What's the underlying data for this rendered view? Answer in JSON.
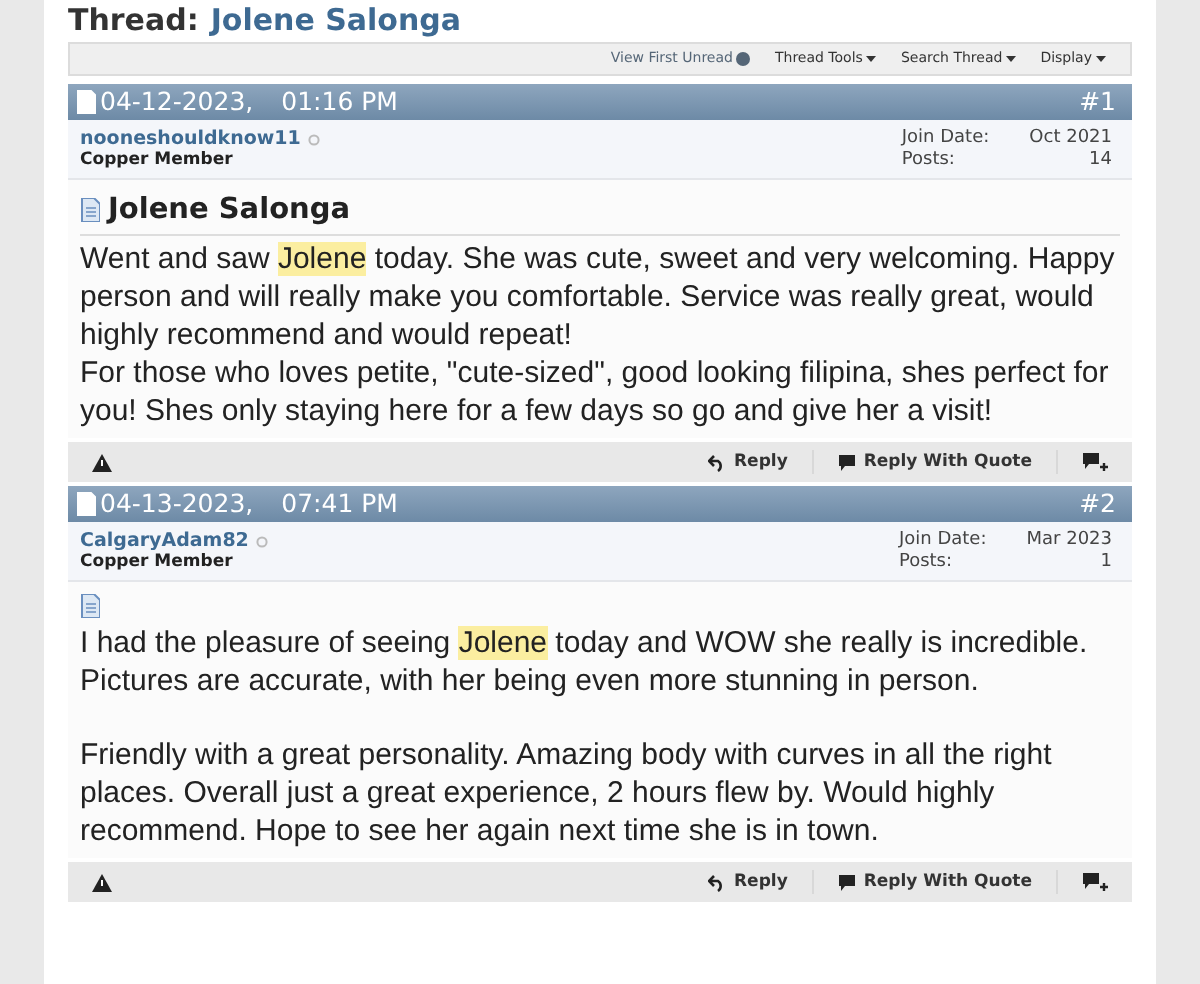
{
  "thread_title": {
    "label": "Thread:",
    "name": "Jolene Salonga"
  },
  "toolbar": [
    {
      "label": "View First Unread",
      "kind": "info"
    },
    {
      "label": "Thread Tools",
      "kind": "menu"
    },
    {
      "label": "Search Thread",
      "kind": "menu"
    },
    {
      "label": "Display",
      "kind": "menu"
    }
  ],
  "posts": [
    {
      "date": "04-12-2023,",
      "time": "01:16 PM",
      "number": "#1",
      "username": "nooneshouldknow11",
      "rank": "Copper Member",
      "join_label": "Join Date:",
      "join_date": "Oct 2021",
      "posts_label": "Posts:",
      "posts": "14",
      "title": "Jolene Salonga",
      "paragraphs": [
        {
          "before": "Went and saw ",
          "highlight": "Jolene",
          "after": " today. She was cute, sweet and very welcoming. Happy person and will really make you comfortable. Service was really great, would highly recommend and would repeat!\nFor those who loves petite, \"cute-sized\", good looking filipina, shes perfect for you! Shes only staying here for a few days so go and give her a visit!"
        }
      ],
      "actions": [
        "Reply",
        "Reply With Quote"
      ]
    },
    {
      "date": "04-13-2023,",
      "time": "07:41 PM",
      "number": "#2",
      "username": "CalgaryAdam82",
      "rank": "Copper Member",
      "join_label": "Join Date:",
      "join_date": "Mar 2023",
      "posts_label": "Posts:",
      "posts": "1",
      "paragraphs": [
        {
          "before": "I had the pleasure of seeing ",
          "highlight": "Jolene",
          "after": " today and WOW she really is incredible. Pictures are accurate, with her being even more stunning in person."
        },
        {
          "before": "Friendly with a great personality. Amazing body with curves in all the right places. Overall just a great experience, 2 hours flew by. Would highly recommend. Hope to see her again next time she is in town."
        }
      ],
      "actions": [
        "Reply",
        "Reply With Quote"
      ]
    }
  ]
}
